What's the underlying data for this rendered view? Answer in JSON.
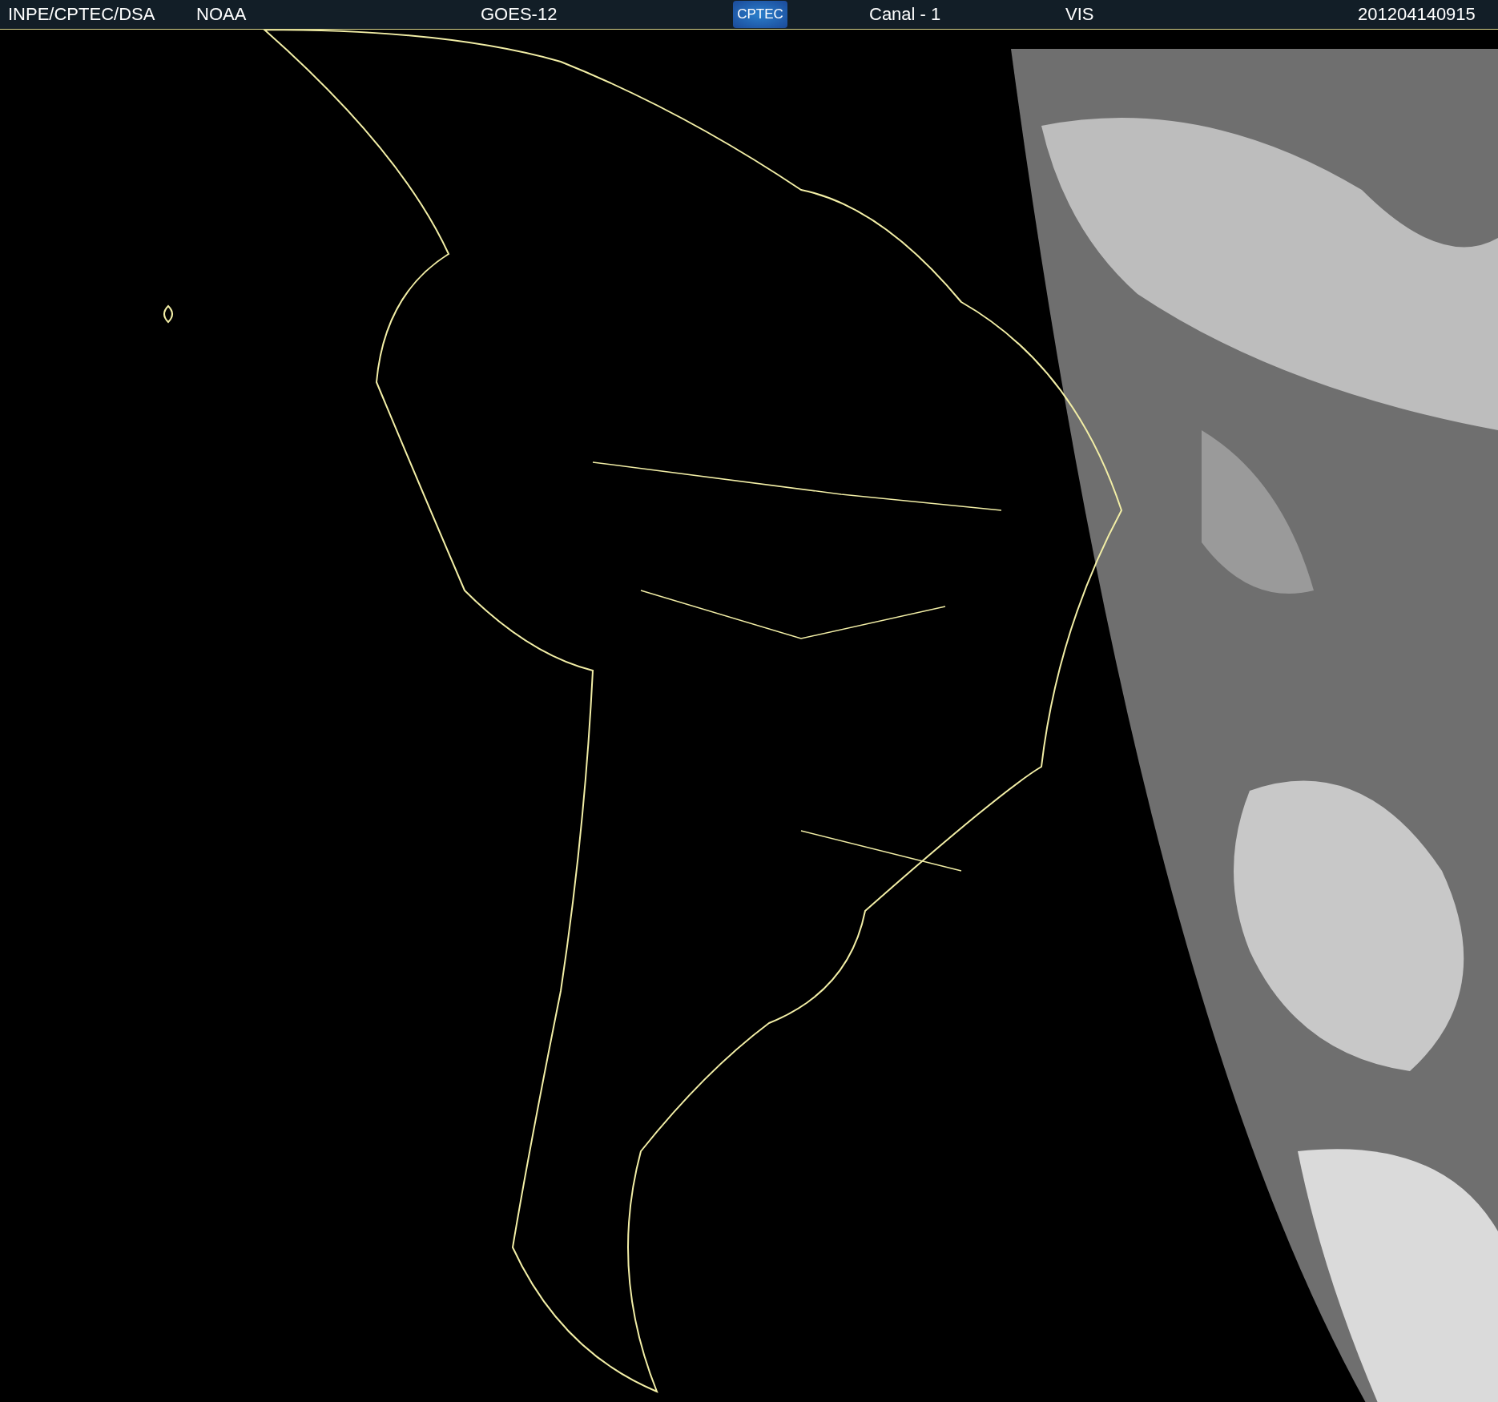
{
  "header": {
    "source": "INPE/CPTEC/DSA",
    "agency": "NOAA",
    "satellite": "GOES-12",
    "logo_text": "CPTEC",
    "channel": "Canal - 1",
    "band": "VIS",
    "timestamp": "201204140915"
  }
}
